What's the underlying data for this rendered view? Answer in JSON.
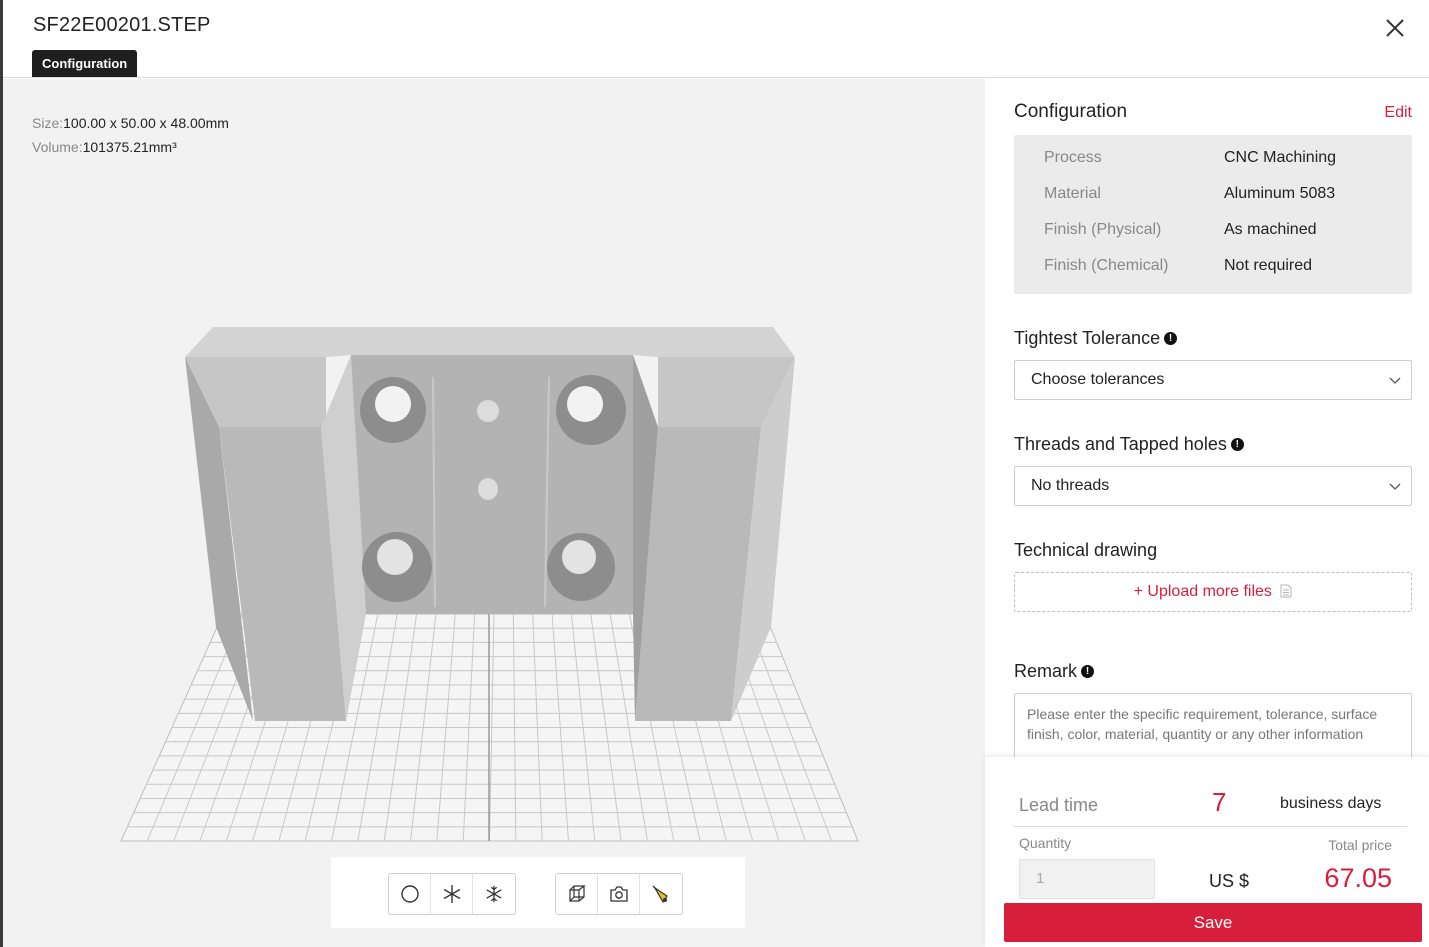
{
  "header": {
    "file_name": "SF22E00201.STEP",
    "tab_label": "Configuration"
  },
  "viewer": {
    "size_label": "Size:",
    "size_value": "100.00 x 50.00 x 48.00mm",
    "volume_label": "Volume:",
    "volume_value": "101375.21mm³",
    "toolbar": {
      "view_modes": [
        "circle-icon",
        "asterisk-icon",
        "snowflake-icon"
      ],
      "actions": [
        "cube-icon",
        "camera-icon",
        "light-icon"
      ]
    }
  },
  "config": {
    "title": "Configuration",
    "edit_label": "Edit",
    "rows": [
      {
        "key": "Process",
        "value": "CNC Machining"
      },
      {
        "key": "Material",
        "value": "Aluminum 5083"
      },
      {
        "key": "Finish (Physical)",
        "value": "As machined"
      },
      {
        "key": "Finish (Chemical)",
        "value": "Not required"
      }
    ]
  },
  "tolerance": {
    "title": "Tightest Tolerance",
    "selected": "Choose tolerances"
  },
  "threads": {
    "title": "Threads and Tapped holes",
    "selected": "No threads"
  },
  "drawing": {
    "title": "Technical drawing",
    "upload_label": "+ Upload more files"
  },
  "remark": {
    "title": "Remark",
    "placeholder": "Please enter the specific requirement, tolerance, surface finish, color, material, quantity or any other information"
  },
  "summary": {
    "lead_label": "Lead time",
    "lead_days": "7",
    "lead_unit": "business days",
    "quantity_label": "Quantity",
    "quantity_value": "1",
    "total_label": "Total price",
    "currency": "US $",
    "price": "67.05",
    "save_label": "Save"
  },
  "colors": {
    "accent": "#d71f3c",
    "panel_bg": "#ebebeb",
    "viewer_bg": "#f2f2f2"
  }
}
